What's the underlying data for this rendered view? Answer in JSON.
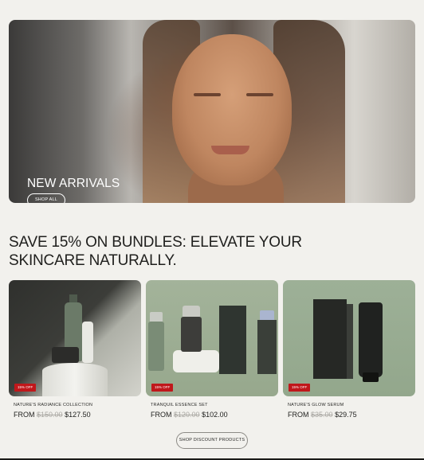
{
  "hero": {
    "title": "NEW ARRIVALS",
    "button_label": "SHOP ALL"
  },
  "section": {
    "title": "SAVE 15% ON BUNDLES: ELEVATE YOUR SKINCARE NATURALLY."
  },
  "products": [
    {
      "name": "NATURE'S RADIANCE COLLECTION",
      "badge": "15% OFF",
      "from_label": "FROM",
      "old_price": "$150.00",
      "price": "$127.50"
    },
    {
      "name": "TRANQUIL ESSENCE SET",
      "badge": "15% OFF",
      "from_label": "FROM",
      "old_price": "$120.00",
      "price": "$102.00"
    },
    {
      "name": "NATURE'S GLOW SERUM",
      "badge": "15% OFF",
      "from_label": "FROM",
      "old_price": "$35.00",
      "price": "$29.75"
    }
  ],
  "cta": {
    "label": "SHOP DISCOUNT PRODUCTS"
  },
  "colors": {
    "background": "#f2f1ed",
    "badge": "#c0171b",
    "sage": "#9db097",
    "text": "#1f1f1d"
  }
}
